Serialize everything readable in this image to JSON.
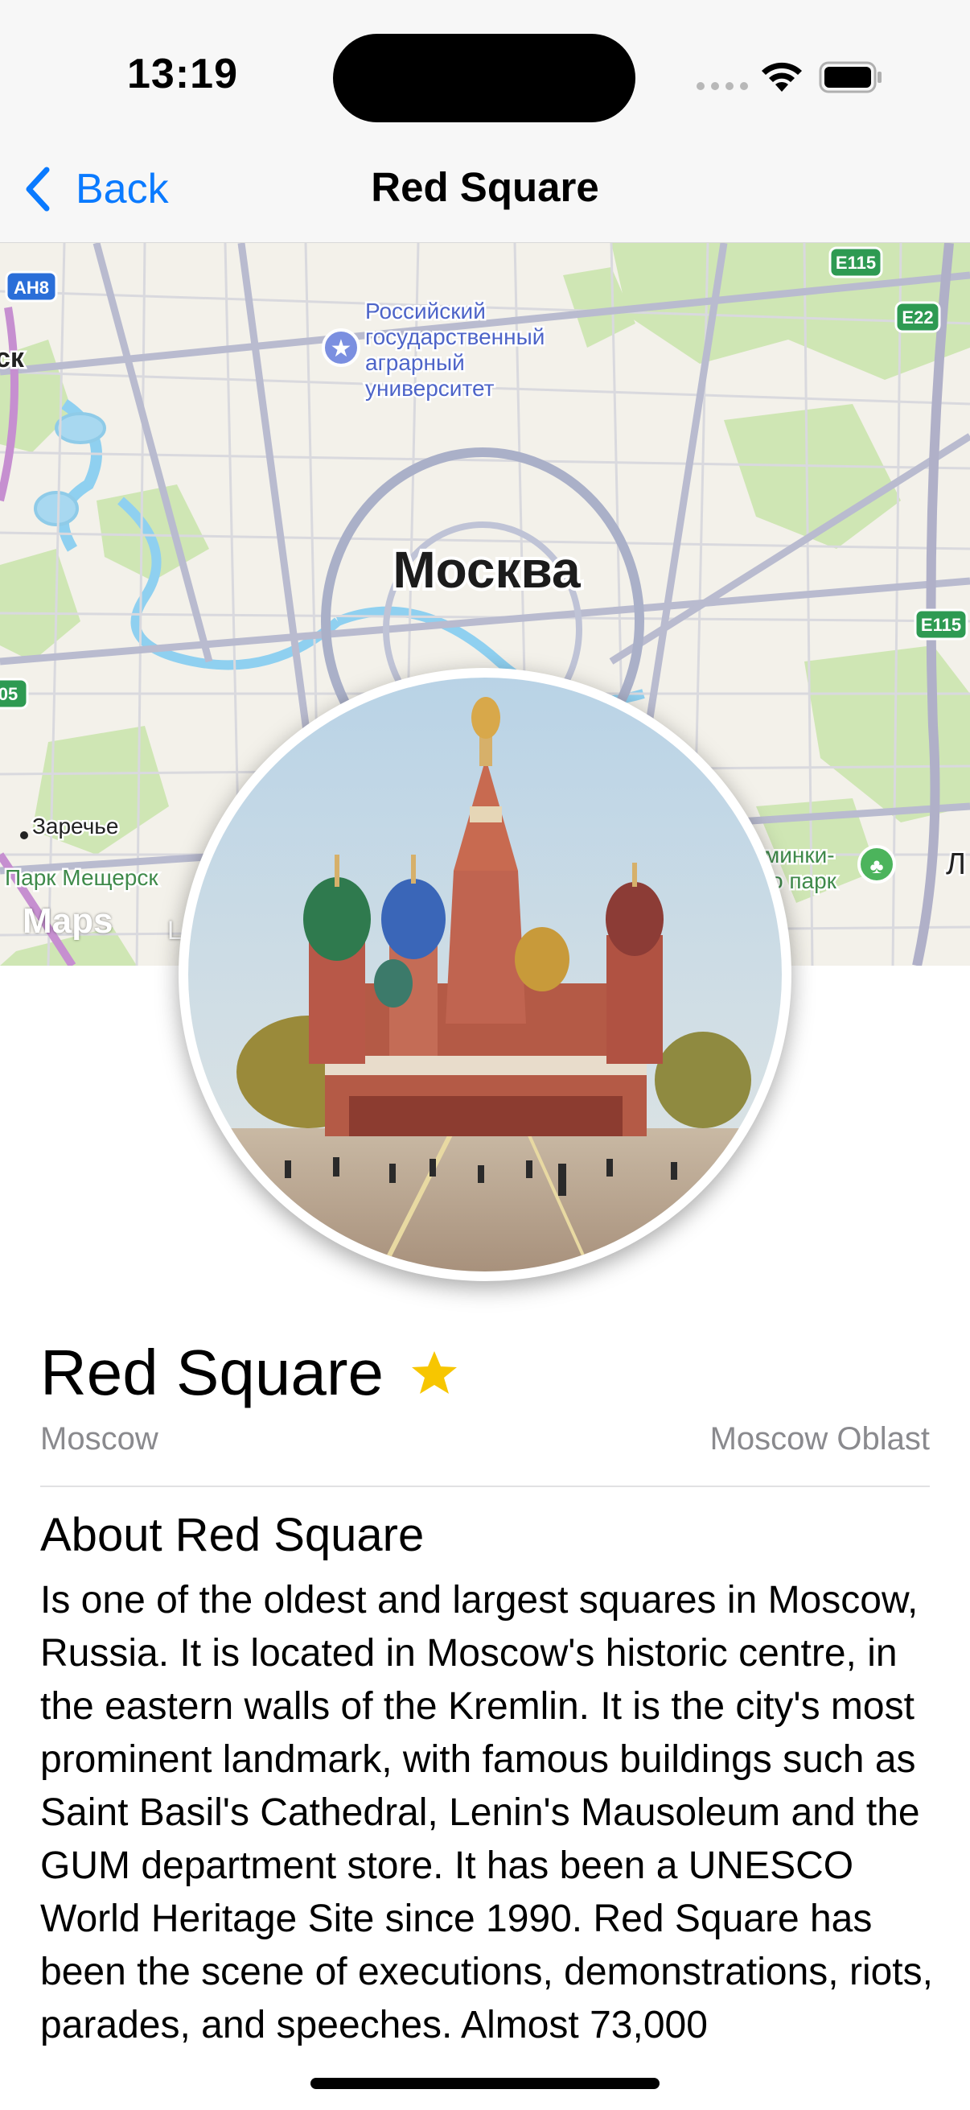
{
  "status_bar": {
    "time": "13:19"
  },
  "nav": {
    "back_label": "Back",
    "title": "Red Square"
  },
  "map": {
    "labels": {
      "city": "Москва",
      "university": [
        "Российский",
        "государственный",
        "аграрный",
        "университет"
      ],
      "zarechye": "Заречье",
      "park_meshchersky": "Парк Мещерск",
      "park_right": [
        "минки-",
        "о парк"
      ],
      "left_edge": "ск",
      "right_edge": "Л"
    },
    "road_badges": {
      "ah8": "AH8",
      "e115_top": "E115",
      "e22": "E22",
      "e115_right": "E115",
      "left_05": "05"
    },
    "attribution": {
      "logo": "Maps",
      "legal": "L"
    }
  },
  "place": {
    "name": "Red Square",
    "favorite": true,
    "city": "Moscow",
    "region": "Moscow Oblast"
  },
  "about": {
    "title": "About Red Square",
    "text": "Is one of the oldest and largest squares in Moscow, Russia. It is located in Moscow's historic centre, in the eastern walls of the Kremlin. It is the city's most prominent landmark, with famous buildings such as Saint Basil's Cathedral, Lenin's Mausoleum and the GUM department store. It has been a UNESCO World Heritage Site since 1990. Red Square has been the scene of executions, demonstrations, riots, parades, and speeches. Almost 73,000"
  },
  "colors": {
    "accent": "#0a7aff",
    "star": "#f7c600",
    "secondary_text": "#8a8a8e"
  },
  "icons": [
    "chevron-left-icon",
    "wifi-icon",
    "battery-icon",
    "star-fill-icon",
    "university-pin-icon",
    "park-pin-icon"
  ]
}
